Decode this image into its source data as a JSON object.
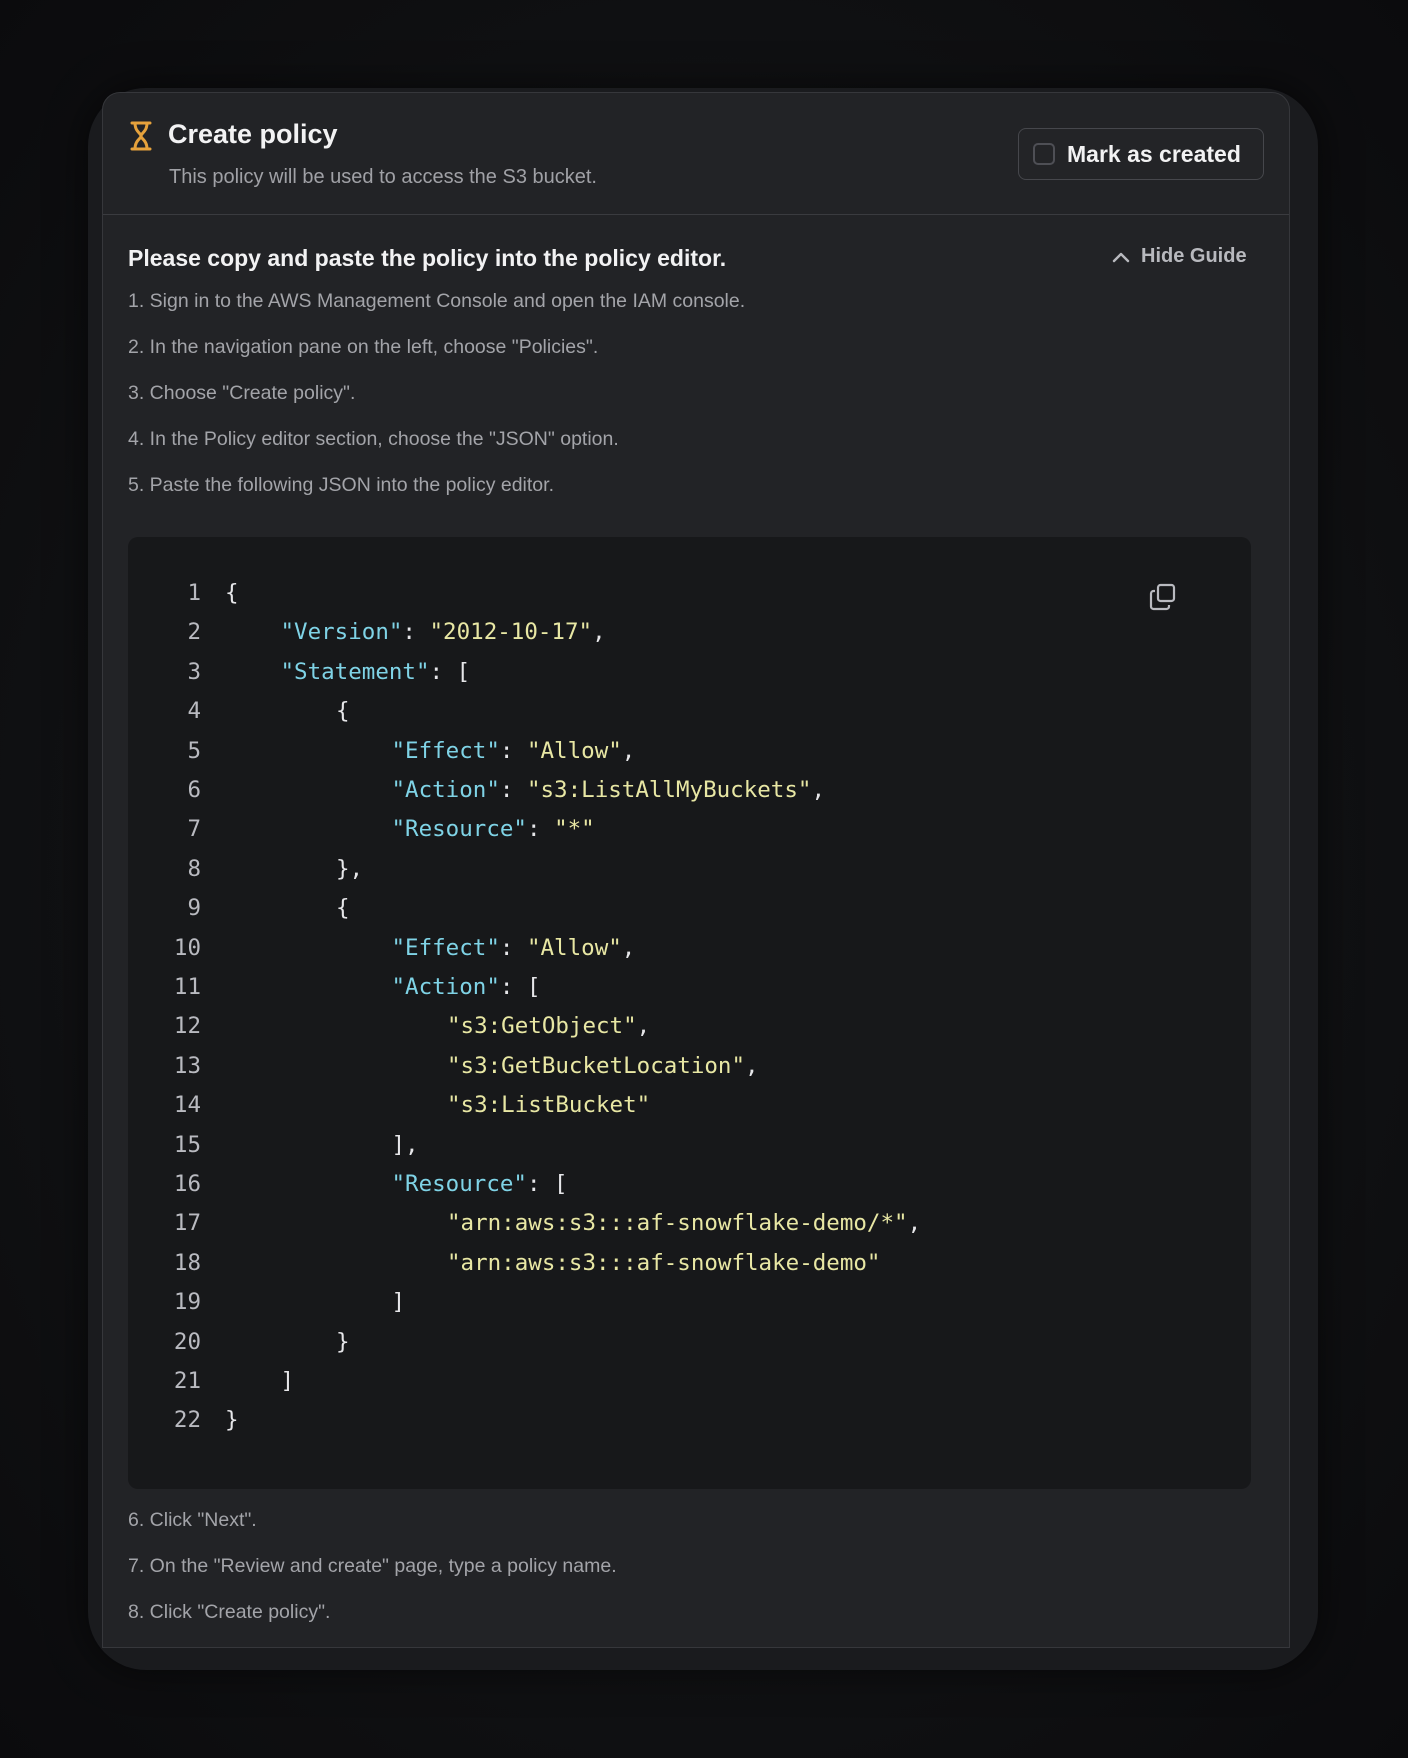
{
  "header": {
    "title": "Create policy",
    "subtitle": "This policy will be used to access the S3 bucket.",
    "mark_label": "Mark as created",
    "accent_color": "#e6a23c"
  },
  "guide": {
    "title": "Please copy and paste the policy into the policy editor.",
    "hide_label": "Hide Guide",
    "steps_before": [
      "1. Sign in to the AWS Management Console and open the IAM console.",
      "2. In the navigation pane on the left, choose \"Policies\".",
      "3. Choose \"Create policy\".",
      "4. In the Policy editor section, choose the \"JSON\" option.",
      "5. Paste the following JSON into the policy editor."
    ],
    "steps_after": [
      "6. Click \"Next\".",
      "7. On the \"Review and create\" page, type a policy name.",
      "8. Click \"Create policy\"."
    ]
  },
  "code": {
    "lines": [
      {
        "n": "1",
        "indent": 0,
        "parts": [
          {
            "t": "p",
            "v": "{"
          }
        ]
      },
      {
        "n": "2",
        "indent": 1,
        "parts": [
          {
            "t": "k",
            "v": "\"Version\""
          },
          {
            "t": "p",
            "v": ": "
          },
          {
            "t": "s",
            "v": "\"2012-10-17\""
          },
          {
            "t": "p",
            "v": ","
          }
        ]
      },
      {
        "n": "3",
        "indent": 1,
        "parts": [
          {
            "t": "k",
            "v": "\"Statement\""
          },
          {
            "t": "p",
            "v": ": ["
          }
        ]
      },
      {
        "n": "4",
        "indent": 2,
        "parts": [
          {
            "t": "p",
            "v": "{"
          }
        ]
      },
      {
        "n": "5",
        "indent": 3,
        "parts": [
          {
            "t": "k",
            "v": "\"Effect\""
          },
          {
            "t": "p",
            "v": ": "
          },
          {
            "t": "s",
            "v": "\"Allow\""
          },
          {
            "t": "p",
            "v": ","
          }
        ]
      },
      {
        "n": "6",
        "indent": 3,
        "parts": [
          {
            "t": "k",
            "v": "\"Action\""
          },
          {
            "t": "p",
            "v": ": "
          },
          {
            "t": "s",
            "v": "\"s3:ListAllMyBuckets\""
          },
          {
            "t": "p",
            "v": ","
          }
        ]
      },
      {
        "n": "7",
        "indent": 3,
        "parts": [
          {
            "t": "k",
            "v": "\"Resource\""
          },
          {
            "t": "p",
            "v": ": "
          },
          {
            "t": "s",
            "v": "\"*\""
          }
        ]
      },
      {
        "n": "8",
        "indent": 2,
        "parts": [
          {
            "t": "p",
            "v": "},"
          }
        ]
      },
      {
        "n": "9",
        "indent": 2,
        "parts": [
          {
            "t": "p",
            "v": "{"
          }
        ]
      },
      {
        "n": "10",
        "indent": 3,
        "parts": [
          {
            "t": "k",
            "v": "\"Effect\""
          },
          {
            "t": "p",
            "v": ": "
          },
          {
            "t": "s",
            "v": "\"Allow\""
          },
          {
            "t": "p",
            "v": ","
          }
        ]
      },
      {
        "n": "11",
        "indent": 3,
        "parts": [
          {
            "t": "k",
            "v": "\"Action\""
          },
          {
            "t": "p",
            "v": ": ["
          }
        ]
      },
      {
        "n": "12",
        "indent": 4,
        "parts": [
          {
            "t": "s",
            "v": "\"s3:GetObject\""
          },
          {
            "t": "p",
            "v": ","
          }
        ]
      },
      {
        "n": "13",
        "indent": 4,
        "parts": [
          {
            "t": "s",
            "v": "\"s3:GetBucketLocation\""
          },
          {
            "t": "p",
            "v": ","
          }
        ]
      },
      {
        "n": "14",
        "indent": 4,
        "parts": [
          {
            "t": "s",
            "v": "\"s3:ListBucket\""
          }
        ]
      },
      {
        "n": "15",
        "indent": 3,
        "parts": [
          {
            "t": "p",
            "v": "],"
          }
        ]
      },
      {
        "n": "16",
        "indent": 3,
        "parts": [
          {
            "t": "k",
            "v": "\"Resource\""
          },
          {
            "t": "p",
            "v": ": ["
          }
        ]
      },
      {
        "n": "17",
        "indent": 4,
        "parts": [
          {
            "t": "s",
            "v": "\"arn:aws:s3:::af-snowflake-demo/*\""
          },
          {
            "t": "p",
            "v": ","
          }
        ]
      },
      {
        "n": "18",
        "indent": 4,
        "parts": [
          {
            "t": "s",
            "v": "\"arn:aws:s3:::af-snowflake-demo\""
          }
        ]
      },
      {
        "n": "19",
        "indent": 3,
        "parts": [
          {
            "t": "p",
            "v": "]"
          }
        ]
      },
      {
        "n": "20",
        "indent": 2,
        "parts": [
          {
            "t": "p",
            "v": "}"
          }
        ]
      },
      {
        "n": "21",
        "indent": 1,
        "parts": [
          {
            "t": "p",
            "v": "]"
          }
        ]
      },
      {
        "n": "22",
        "indent": 0,
        "parts": [
          {
            "t": "p",
            "v": "}"
          }
        ]
      }
    ],
    "copy_icon": "copy-icon"
  }
}
